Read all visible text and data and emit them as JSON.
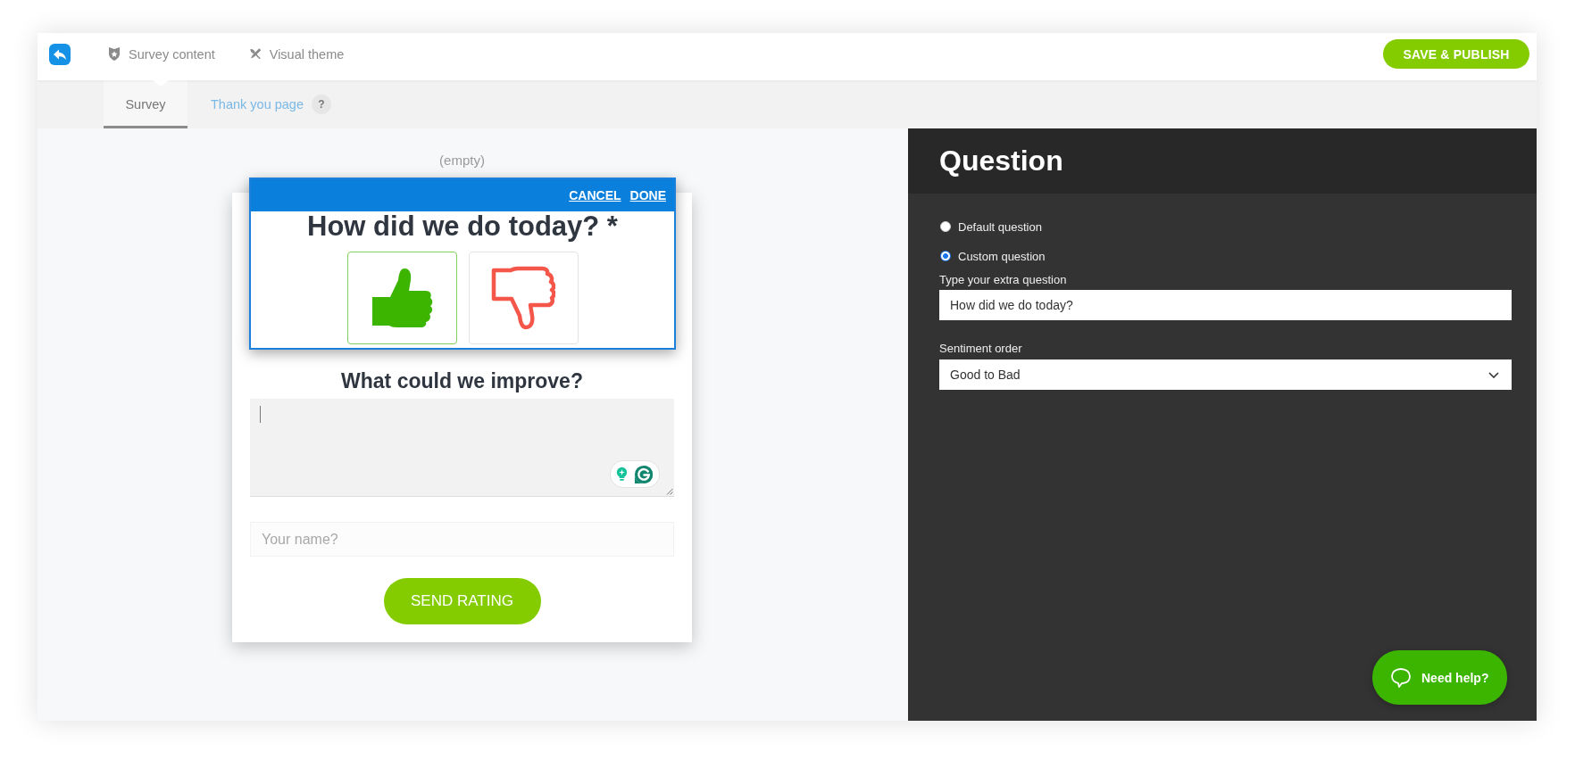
{
  "header": {
    "nav": [
      {
        "label": "Survey content",
        "selected": true
      },
      {
        "label": "Visual theme",
        "selected": false
      }
    ],
    "publish_button": "SAVE & PUBLISH"
  },
  "subtabs": [
    {
      "label": "Survey",
      "selected": true
    },
    {
      "label": "Thank you page",
      "selected": false,
      "help": "?"
    }
  ],
  "canvas": {
    "empty_label": "(empty)",
    "editor": {
      "actions": [
        "CANCEL",
        "DONE"
      ],
      "question": "How did we do today? *",
      "options": [
        {
          "kind": "thumbs-up",
          "selected": true
        },
        {
          "kind": "thumbs-down",
          "selected": false
        }
      ]
    },
    "improve_title": "What could we improve?",
    "name_field": {
      "placeholder": "Your name?"
    },
    "submit_button": "SEND RATING"
  },
  "panel": {
    "title": "Question",
    "question_type": [
      {
        "label": "Default question",
        "selected": false
      },
      {
        "label": "Custom question",
        "selected": true
      }
    ],
    "question_field": {
      "label": "Type your extra question",
      "value": "How did we do today?"
    },
    "sentiment_order": {
      "label": "Sentiment order",
      "value": "Good to Bad"
    }
  },
  "help_button": "Need help?"
}
